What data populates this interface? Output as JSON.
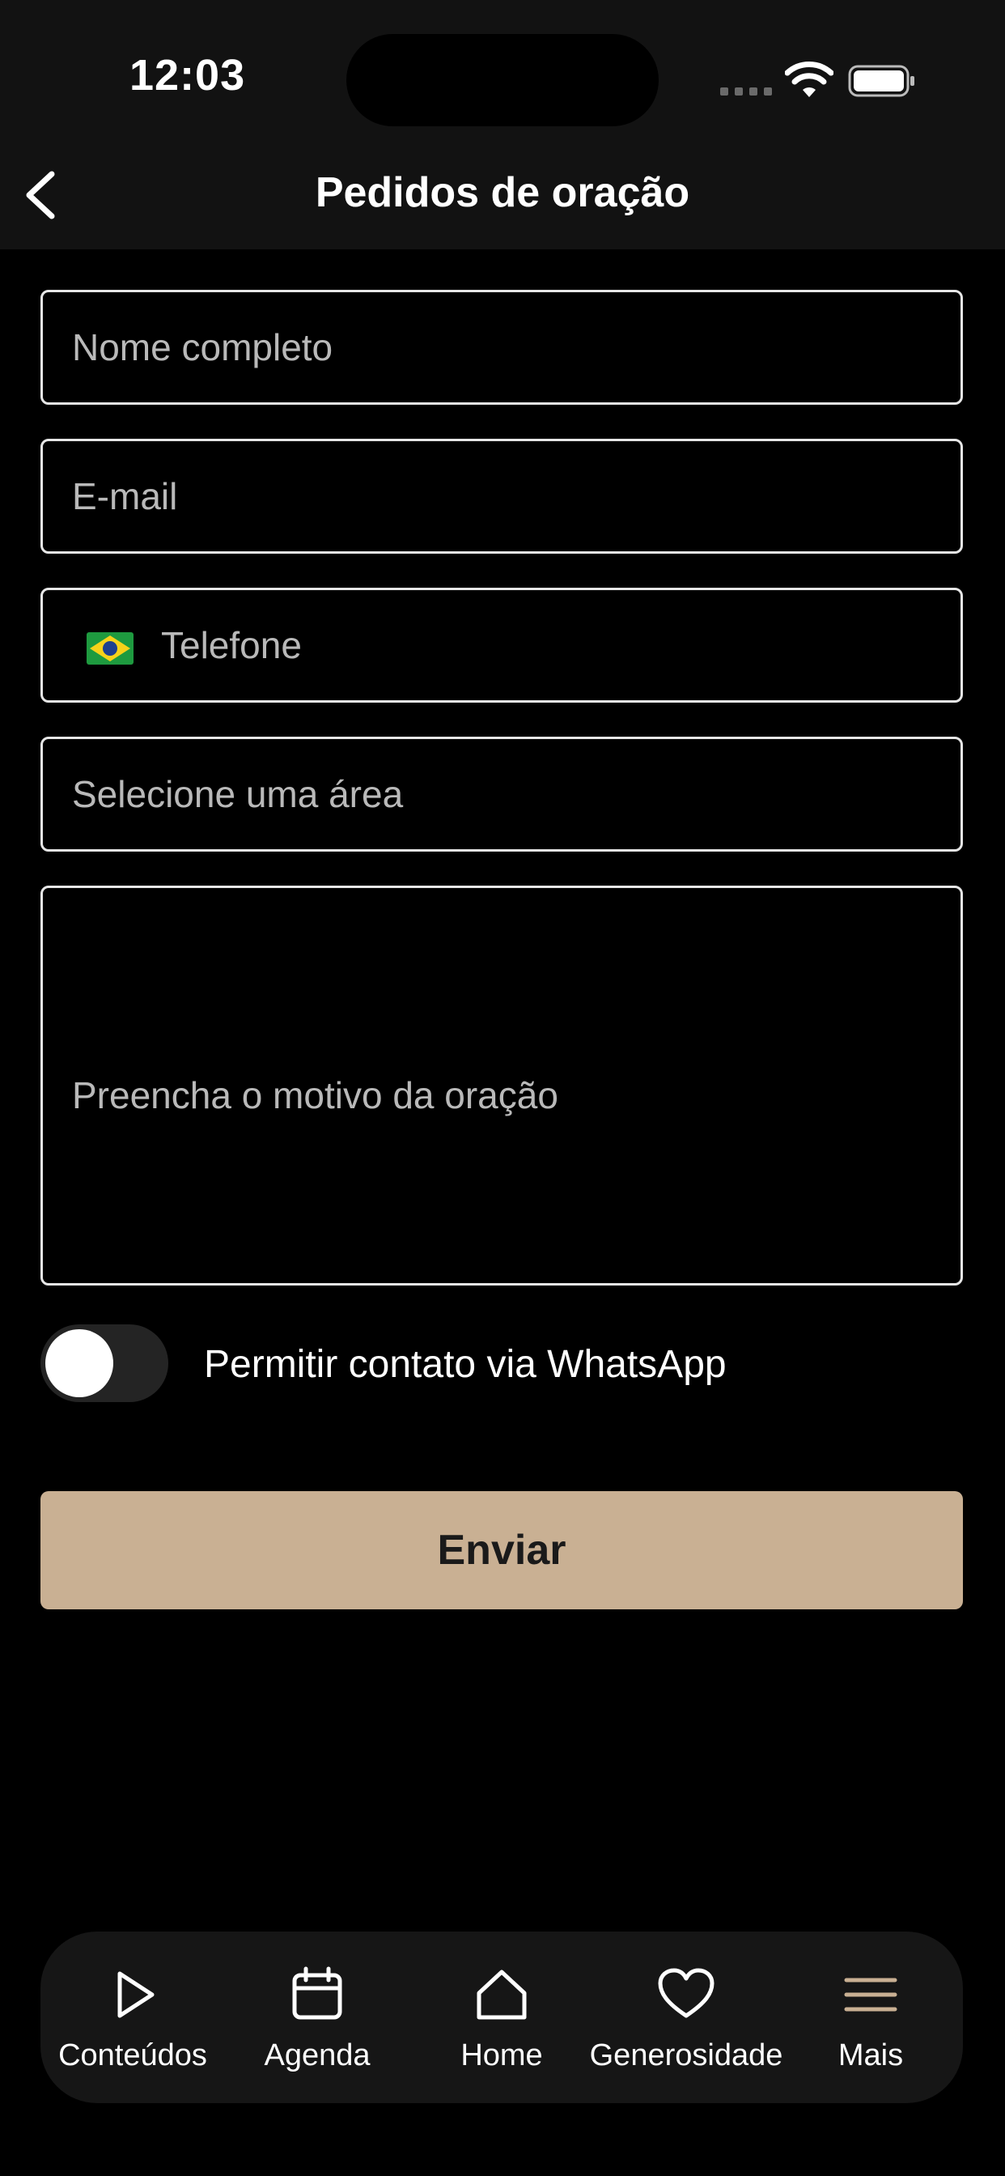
{
  "status_bar": {
    "time": "12:03"
  },
  "header": {
    "title": "Pedidos de oração"
  },
  "form": {
    "name_placeholder": "Nome completo",
    "email_placeholder": "E-mail",
    "phone_placeholder": "Telefone",
    "area_placeholder": "Selecione uma área",
    "reason_placeholder": "Preencha o motivo da oração",
    "whatsapp_toggle_label": "Permitir contato via WhatsApp",
    "whatsapp_toggle_on": false,
    "submit_label": "Enviar"
  },
  "tab_bar": {
    "items": [
      {
        "label": "Conteúdos",
        "icon": "play-icon"
      },
      {
        "label": "Agenda",
        "icon": "calendar-icon"
      },
      {
        "label": "Home",
        "icon": "home-icon"
      },
      {
        "label": "Generosidade",
        "icon": "heart-icon"
      },
      {
        "label": "Mais",
        "icon": "menu-icon"
      }
    ]
  },
  "colors": {
    "background": "#000000",
    "header": "#121212",
    "accent": "#c9b093",
    "tabbar": "#161616"
  }
}
